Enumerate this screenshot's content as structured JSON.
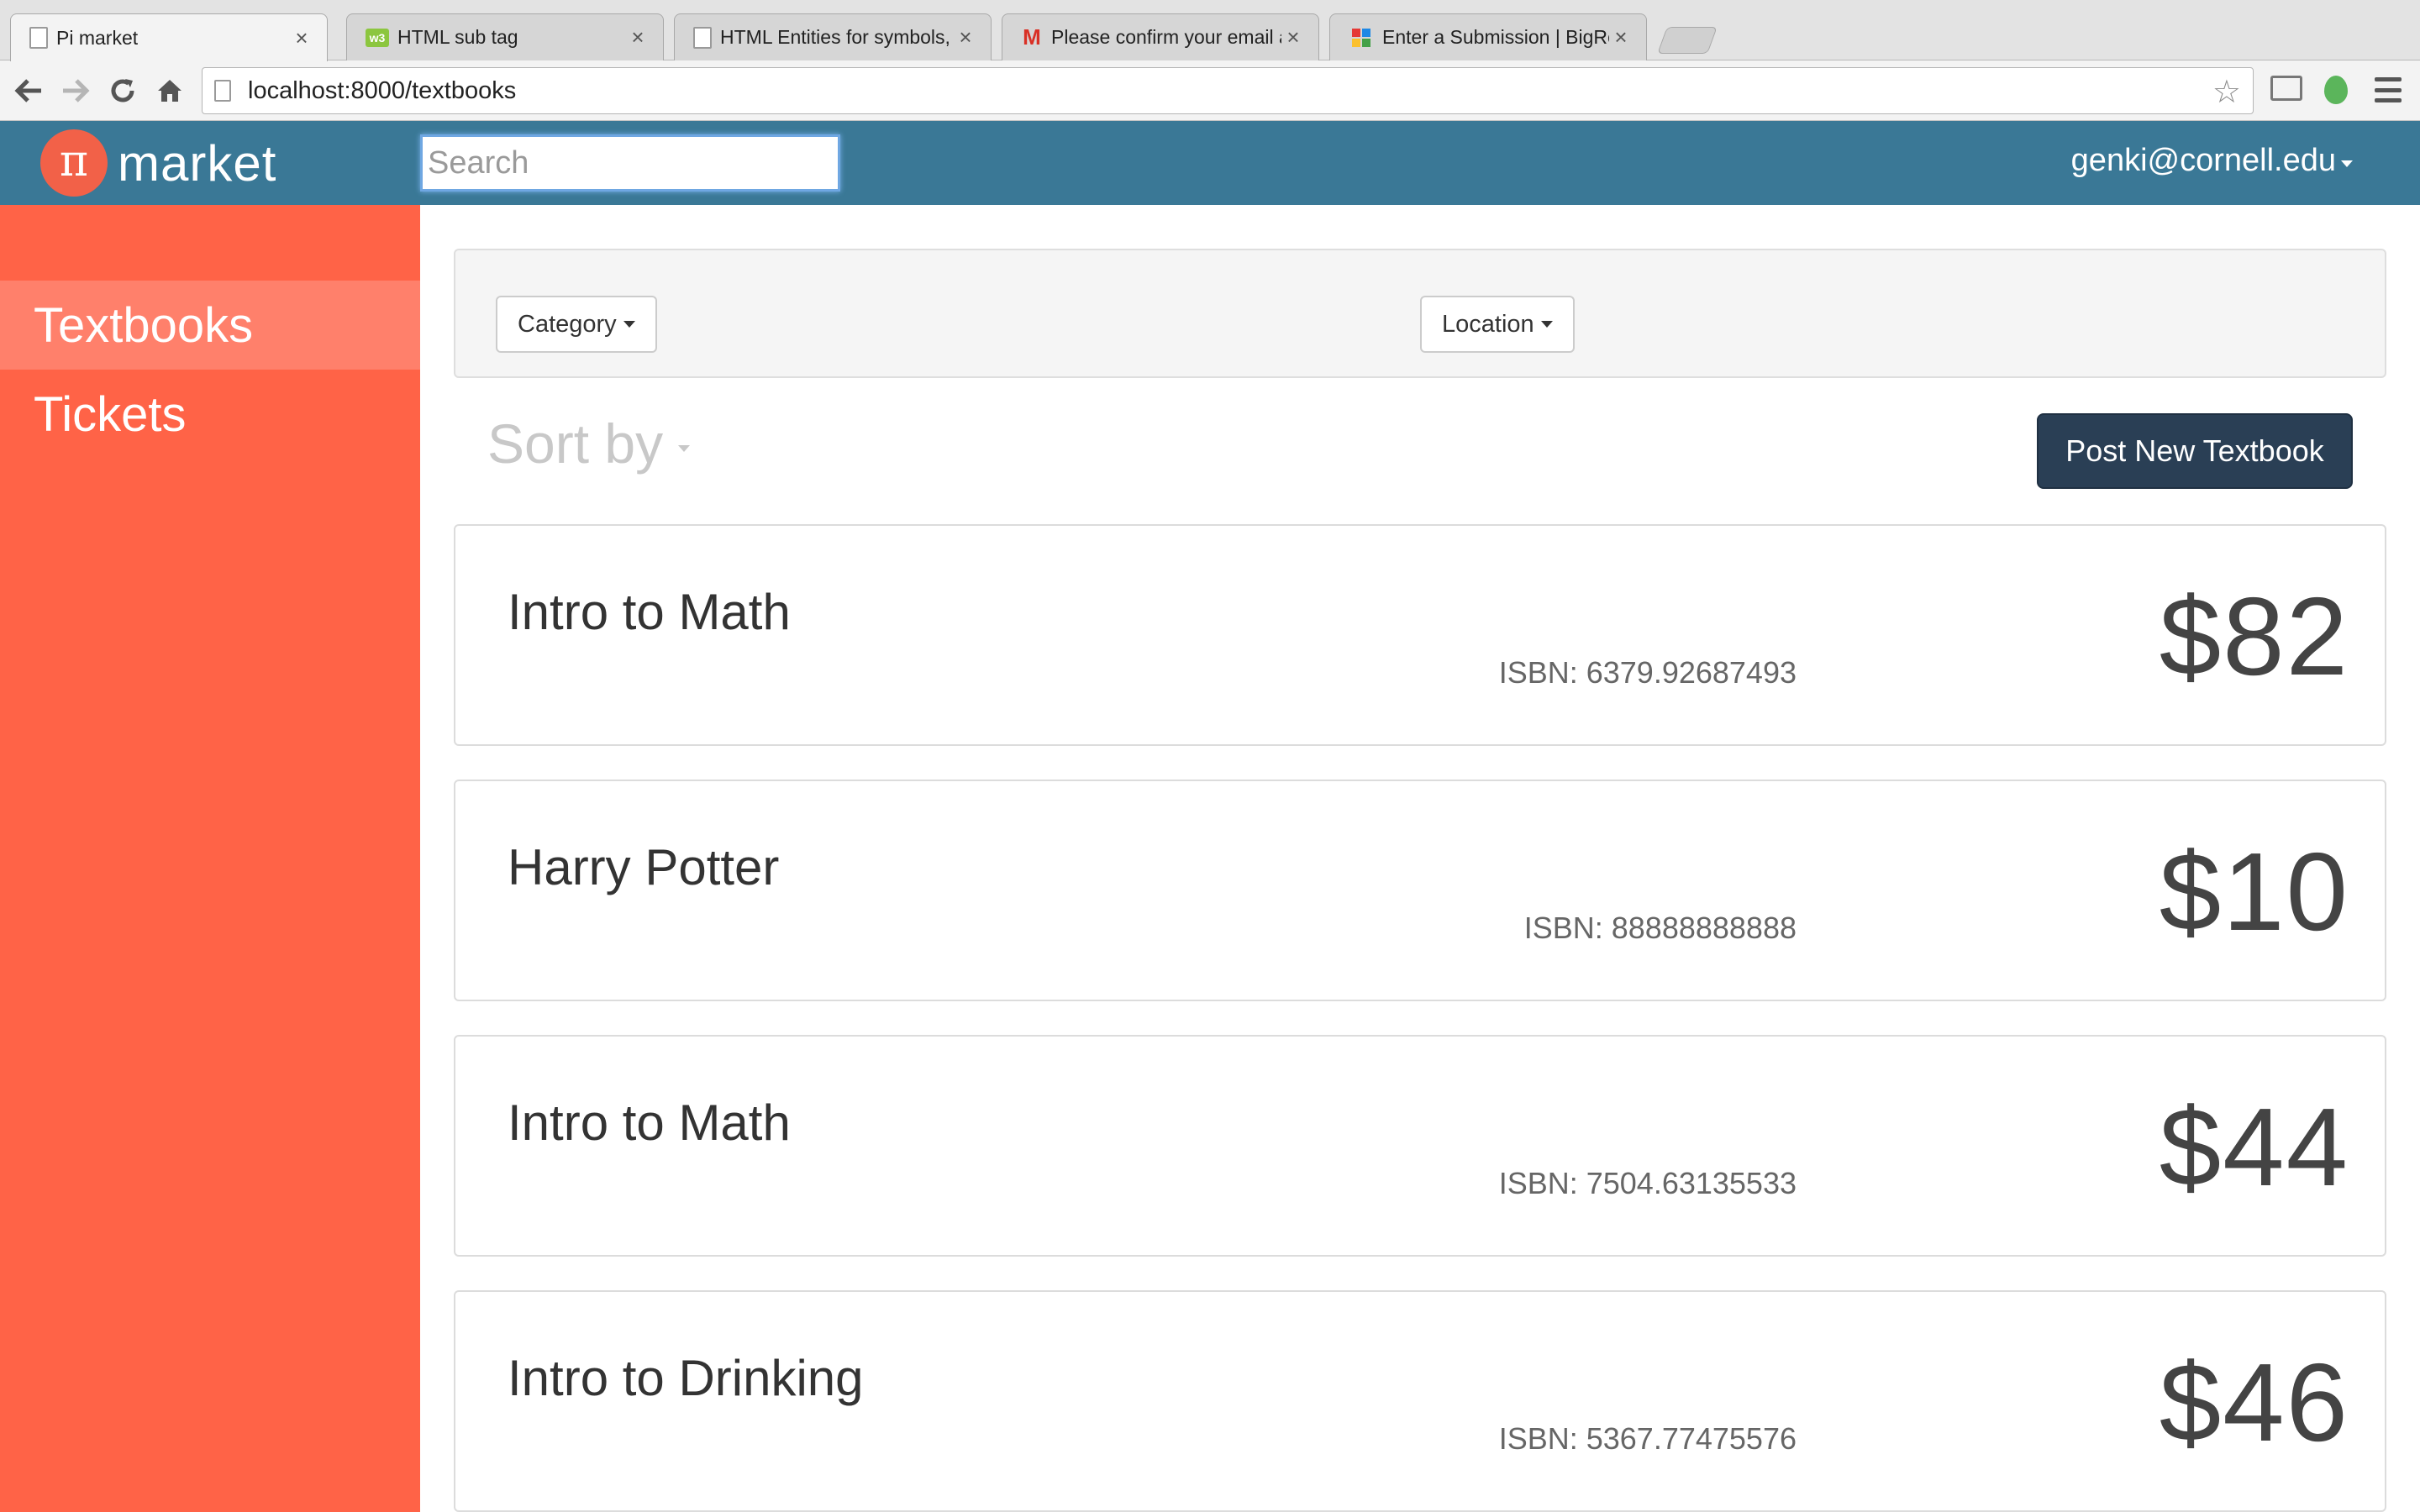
{
  "browser": {
    "tabs": [
      {
        "title": "Pi market",
        "icon": "page-icon",
        "active": true
      },
      {
        "title": "HTML sub tag",
        "icon": "w3schools-icon",
        "active": false
      },
      {
        "title": "HTML Entities for symbols, ",
        "icon": "page-icon",
        "active": false
      },
      {
        "title": "Please confirm your email a",
        "icon": "gmail-icon",
        "active": false
      },
      {
        "title": "Enter a Submission | BigRec",
        "icon": "pin-icon",
        "active": false
      }
    ],
    "tab_close_glyph": "×",
    "url": "localhost:8000/textbooks"
  },
  "header": {
    "logo_symbol": "π",
    "brand": "market",
    "search_placeholder": "Search",
    "user_email": "genki@cornell.edu"
  },
  "sidebar": {
    "items": [
      {
        "label": "Textbooks",
        "active": true
      },
      {
        "label": "Tickets",
        "active": false
      }
    ]
  },
  "filters": {
    "category_label": "Category",
    "location_label": "Location"
  },
  "sort": {
    "label": "Sort by"
  },
  "actions": {
    "post_label": "Post New Textbook"
  },
  "listings": [
    {
      "title": "Intro to Math",
      "isbn": "ISBN: 6379.92687493",
      "price": "$82"
    },
    {
      "title": "Harry Potter",
      "isbn": "ISBN: 88888888888",
      "price": "$10"
    },
    {
      "title": "Intro to Math",
      "isbn": "ISBN: 7504.63135533",
      "price": "$44"
    },
    {
      "title": "Intro to Drinking",
      "isbn": "ISBN: 5367.77475576",
      "price": "$46"
    }
  ],
  "colors": {
    "header": "#3a7896",
    "sidebar": "#ff6347",
    "sidebar_active": "#ff806b",
    "logo": "#f26148",
    "post_button": "#2a3f55"
  }
}
